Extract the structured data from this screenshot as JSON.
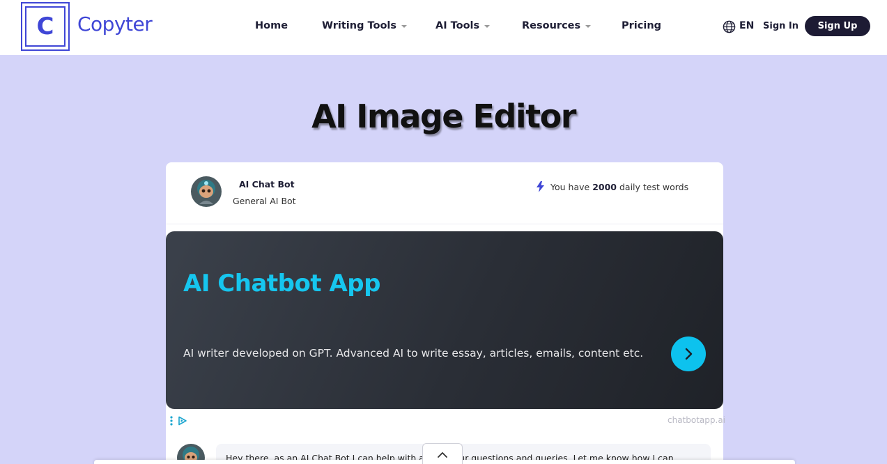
{
  "brand": {
    "logo_letter": "C",
    "name": "Copyter"
  },
  "nav": {
    "home": "Home",
    "writing_tools": "Writing Tools",
    "ai_tools": "AI Tools",
    "resources": "Resources",
    "pricing": "Pricing"
  },
  "header_right": {
    "language": "EN",
    "sign_in": "Sign In",
    "sign_up": "Sign Up"
  },
  "page": {
    "title": "AI Image Editor"
  },
  "bot": {
    "name": "AI Chat Bot",
    "subtitle": "General AI Bot"
  },
  "quota": {
    "prefix": "You have",
    "amount": "2000",
    "suffix": "daily test words"
  },
  "ad": {
    "title": "AI Chatbot App",
    "description": "AI writer developed on GPT. Advanced AI to write essay, articles, emails, content etc.",
    "domain": "chatbotapp.ai"
  },
  "message": {
    "text": "Hey there, as an AI Chat Bot I can help with any of your questions and queries. Let me know how I can"
  },
  "icons": {
    "globe": "globe-icon",
    "bolt": "bolt-icon",
    "chevron_right": "chevron-right-icon",
    "chevron_up": "chevron-up-icon",
    "more": "more-vertical-icon",
    "ad_choices": "ad-choices-icon"
  },
  "colors": {
    "brand": "#3f46d6",
    "background": "#d4d4f9",
    "accent": "#16c6ef",
    "dark": "#1d1b34"
  }
}
